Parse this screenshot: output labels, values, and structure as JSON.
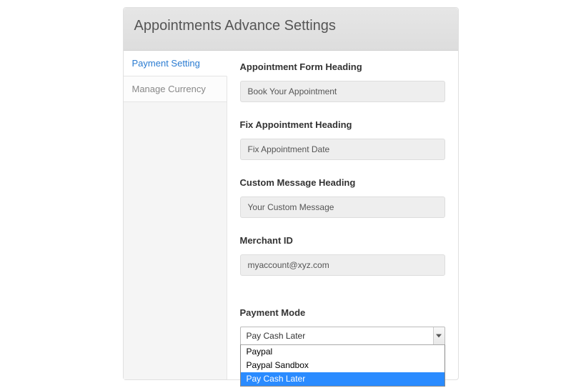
{
  "header": {
    "title": "Appointments Advance Settings"
  },
  "sidebar": {
    "items": [
      {
        "label": "Payment Setting"
      },
      {
        "label": "Manage Currency"
      }
    ]
  },
  "form": {
    "heading_label": "Appointment Form Heading",
    "heading_value": "Book Your Appointment",
    "fix_label": "Fix Appointment Heading",
    "fix_value": "Fix Appointment Date",
    "custom_label": "Custom Message Heading",
    "custom_value": "Your Custom Message",
    "merchant_label": "Merchant ID",
    "merchant_value": "myaccount@xyz.com",
    "payment_label": "Payment Mode",
    "payment_selected": "Pay Cash Later",
    "payment_options": [
      "Paypal",
      "Paypal Sandbox",
      "Pay Cash Later"
    ]
  }
}
